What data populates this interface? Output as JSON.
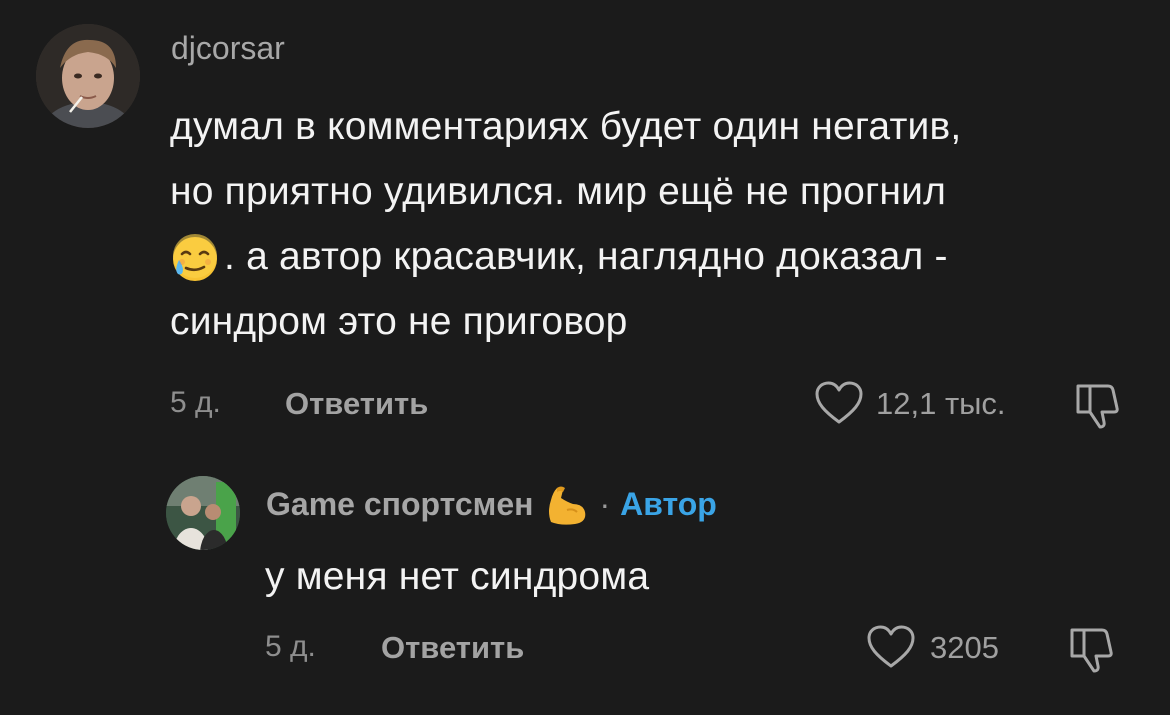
{
  "comments": [
    {
      "username": "djcorsar",
      "text_line1": "думал в комментариях будет один негатив,",
      "text_line2": "но приятно удивился. мир ещё не прогнил",
      "text_line3": ". а автор красавчик, наглядно доказал -",
      "text_line4": "синдром это не приговор",
      "emoji": "face-holding-back-tears-emoji",
      "age": "5 д.",
      "reply_label": "Ответить",
      "likes": "12,1 тыс.",
      "like_icon": "heart-outline-icon",
      "dislike_icon": "thumbs-down-outline-icon"
    },
    {
      "username": "Game спортсмен",
      "badge_emoji": "flexed-biceps-emoji",
      "separator": "·",
      "author_label": "Автор",
      "text": "у меня нет синдрома",
      "age": "5 д.",
      "reply_label": "Ответить",
      "likes": "3205",
      "like_icon": "heart-outline-icon",
      "dislike_icon": "thumbs-down-outline-icon"
    }
  ]
}
